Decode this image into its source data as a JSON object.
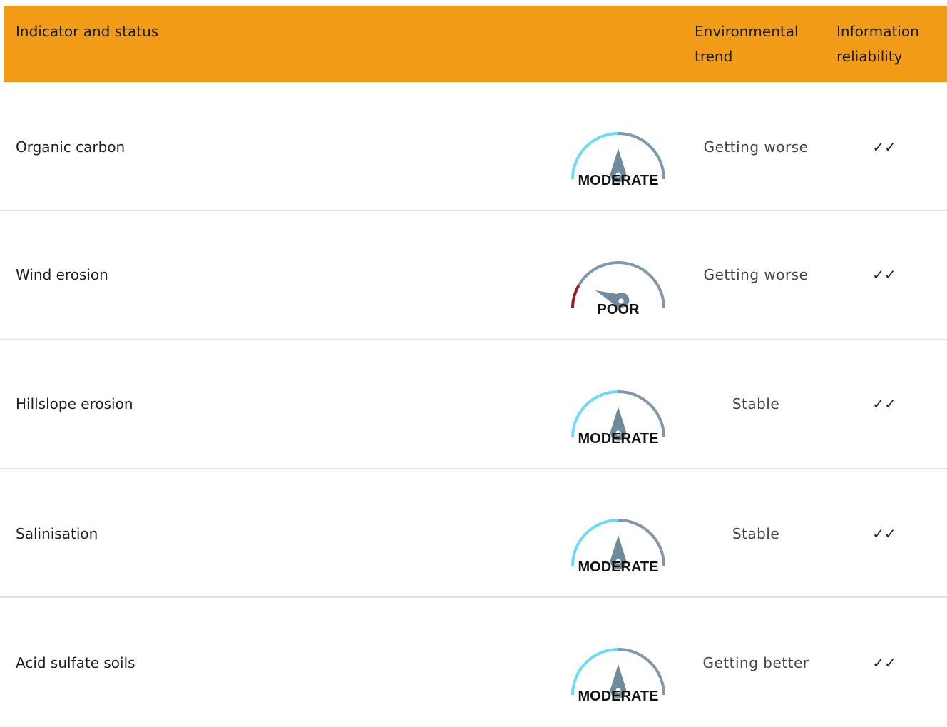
{
  "header": {
    "col1": "Indicator and status",
    "col2": "Environmental trend",
    "col3": "Information reliability"
  },
  "colors": {
    "header_bg": "#f29b16",
    "good_arc": "#6cdcf6",
    "gray_arc": "#8098a8",
    "poor_arc": "#9b1c1c",
    "needle": "#6f8a9b"
  },
  "rows": [
    {
      "name": "Organic carbon",
      "status": "MODERATE",
      "status_level": "moderate",
      "trend": "Getting worse",
      "reliability": "✓✓"
    },
    {
      "name": "Wind erosion",
      "status": "POOR",
      "status_level": "poor",
      "trend": "Getting worse",
      "reliability": "✓✓"
    },
    {
      "name": "Hillslope erosion",
      "status": "MODERATE",
      "status_level": "moderate",
      "trend": "Stable",
      "reliability": "✓✓"
    },
    {
      "name": "Salinisation",
      "status": "MODERATE",
      "status_level": "moderate",
      "trend": "Stable",
      "reliability": "✓✓"
    },
    {
      "name": "Acid sulfate soils",
      "status": "MODERATE",
      "status_level": "moderate",
      "trend": "Getting better",
      "reliability": "✓✓"
    }
  ]
}
